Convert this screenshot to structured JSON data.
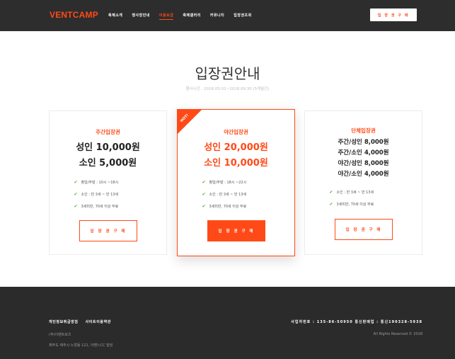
{
  "header": {
    "logo": "VENTCAMP",
    "nav": [
      "축제소개",
      "행사장안내",
      "이용요금",
      "축제갤러리",
      "커뮤니티",
      "입장권조회"
    ],
    "active_index": 2,
    "cta": "입 장 권 구 매",
    "accent_color": "#ff4a17"
  },
  "main": {
    "title": "입장권안내",
    "subtitle": "행사시간 : 2018.05.01~2018.09.30 (5개월간)",
    "cards": [
      {
        "name": "주간입장권",
        "prices": [
          "성인 10,000원",
          "소인 5,000원"
        ],
        "features": [
          "평일/주말 : 10시 ~18시",
          "소인 : 만 3세 ~ 만 13세",
          "3세미만, 70세 이상 무료"
        ],
        "button": "입 장 권 구 매"
      },
      {
        "ribbon": "HOT!",
        "name": "야간입장권",
        "prices": [
          "성인 20,000원",
          "소인 10,000원"
        ],
        "features": [
          "평일/주말 : 18시 ~22시",
          "소인 : 만 3세 ~ 만 13세",
          "3세미만, 70세 이상 무료"
        ],
        "button": "입 장 권 구 매"
      },
      {
        "name": "단체입장권",
        "prices": [
          "주간/성인 8,000원",
          "주간/소인 4,000원",
          "야간/성인 8,000원",
          "야간/소인 4,000원"
        ],
        "features": [
          "소인 : 만 3세 ~ 만 13세",
          "3세미만, 70세 이상 무료"
        ],
        "button": "입 장 권 구 매"
      }
    ]
  },
  "footer": {
    "links": [
      "개인정보취급방침",
      "사이트이용약관"
    ],
    "company": "(주)이벤트포츠",
    "address": "제주도 제주시 노형동 121, 아벤느CC 빌딩",
    "business": "사업자번호 : 135-86-50950    통신판매업 : 통신190328-5938",
    "copyright": "All Rights Reserved © 2018"
  }
}
